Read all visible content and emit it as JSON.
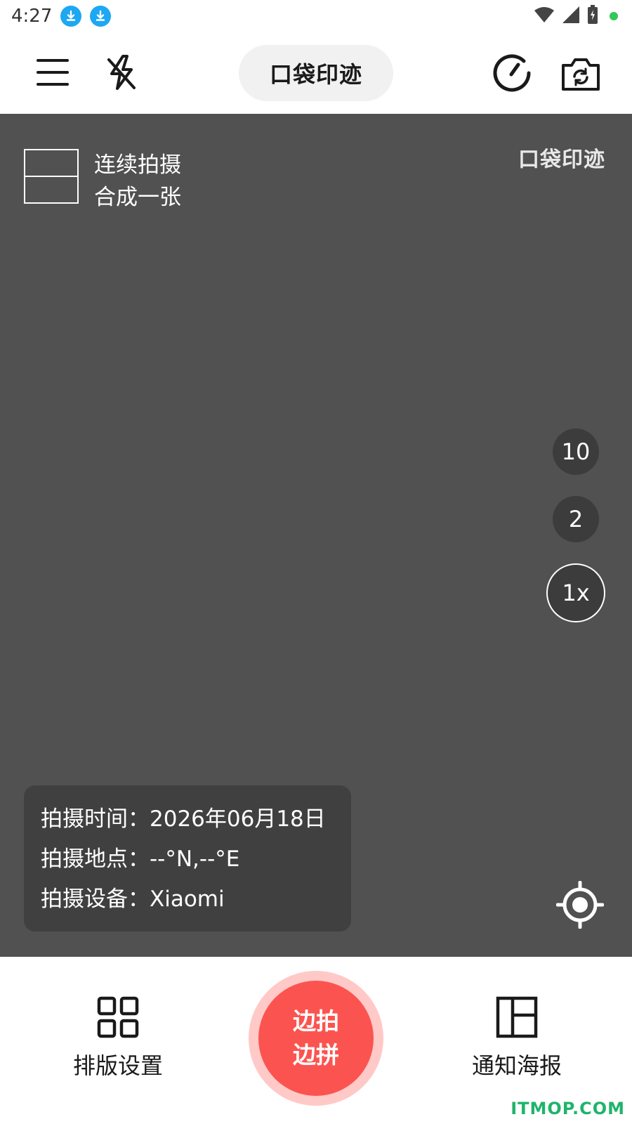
{
  "status_bar": {
    "time": "4:27"
  },
  "toolbar": {
    "title": "口袋印迹"
  },
  "viewfinder": {
    "mode_line1": "连续拍摄",
    "mode_line2": "合成一张",
    "watermark": "口袋印迹",
    "zoom_options": [
      "10",
      "2",
      "1x"
    ],
    "selected_zoom": "1x"
  },
  "info_panel": {
    "time_row": "拍摄时间：2026年06月18日",
    "location_row": "拍摄地点：--°N,--°E",
    "device_row": "拍摄设备：Xiaomi"
  },
  "bottom_bar": {
    "layout_label": "排版设置",
    "shutter_line1": "边拍",
    "shutter_line2": "边拼",
    "poster_label": "通知海报"
  },
  "site_mark": "ITMOP.COM",
  "colors": {
    "viewfinder_bg": "#515151",
    "shutter": "#fb5450",
    "shutter_ring": "#ffc9c7",
    "download_badge": "#1ea7f2",
    "site_mark": "#1fb46b"
  }
}
